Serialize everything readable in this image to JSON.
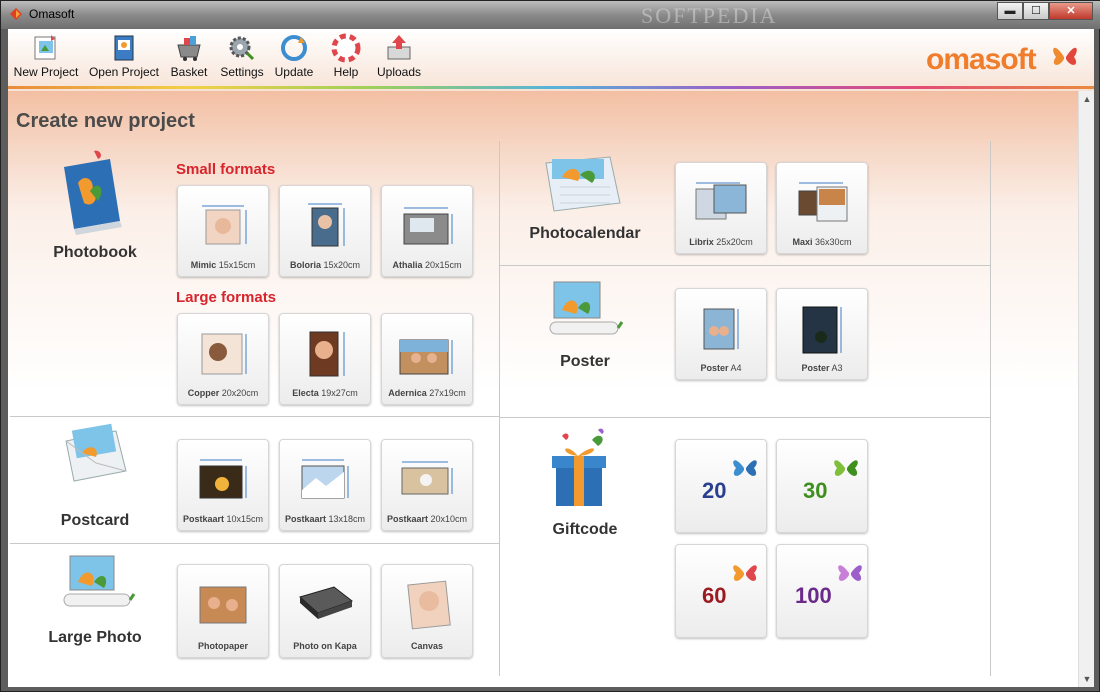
{
  "window": {
    "title": "Omasoft",
    "watermark": "SOFTPEDIA",
    "buttons": {
      "minimize": "▬",
      "maximize": "☐",
      "close": "✕"
    }
  },
  "toolbar": {
    "items": [
      {
        "label": "New Project",
        "icon": "new-project-icon"
      },
      {
        "label": "Open Project",
        "icon": "open-project-icon"
      },
      {
        "label": "Basket",
        "icon": "basket-icon"
      },
      {
        "label": "Settings",
        "icon": "settings-icon"
      },
      {
        "label": "Update",
        "icon": "update-icon"
      },
      {
        "label": "Help",
        "icon": "help-icon"
      },
      {
        "label": "Uploads",
        "icon": "uploads-icon"
      }
    ],
    "logo": "omasoft"
  },
  "page": {
    "title": "Create new project"
  },
  "photobook": {
    "label": "Photobook",
    "small_heading": "Small formats",
    "large_heading": "Large formats",
    "small": [
      {
        "name": "Mimic",
        "size": "15x15cm"
      },
      {
        "name": "Boloria",
        "size": "15x20cm"
      },
      {
        "name": "Athalia",
        "size": "20x15cm"
      }
    ],
    "large": [
      {
        "name": "Copper",
        "size": "20x20cm"
      },
      {
        "name": "Electa",
        "size": "19x27cm"
      },
      {
        "name": "Adernica",
        "size": "27x19cm"
      }
    ]
  },
  "postcard": {
    "label": "Postcard",
    "items": [
      {
        "name": "Postkaart",
        "size": "10x15cm"
      },
      {
        "name": "Postkaart",
        "size": "13x18cm"
      },
      {
        "name": "Postkaart",
        "size": "20x10cm"
      }
    ]
  },
  "largephoto": {
    "label": "Large Photo",
    "items": [
      {
        "name": "Photopaper",
        "size": ""
      },
      {
        "name": "Photo on Kapa",
        "size": ""
      },
      {
        "name": "Canvas",
        "size": ""
      }
    ]
  },
  "photocalendar": {
    "label": "Photocalendar",
    "items": [
      {
        "name": "Librix",
        "size": "25x20cm"
      },
      {
        "name": "Maxi",
        "size": "36x30cm"
      }
    ]
  },
  "poster": {
    "label": "Poster",
    "items": [
      {
        "name": "Poster",
        "size": "A4"
      },
      {
        "name": "Poster",
        "size": "A3"
      }
    ]
  },
  "giftcode": {
    "label": "Giftcode",
    "items": [
      {
        "value": "20",
        "color": "#2b3f8f"
      },
      {
        "value": "30",
        "color": "#3f8f1f"
      },
      {
        "value": "60",
        "color": "#9a1b22"
      },
      {
        "value": "100",
        "color": "#6b2a8a"
      }
    ]
  }
}
